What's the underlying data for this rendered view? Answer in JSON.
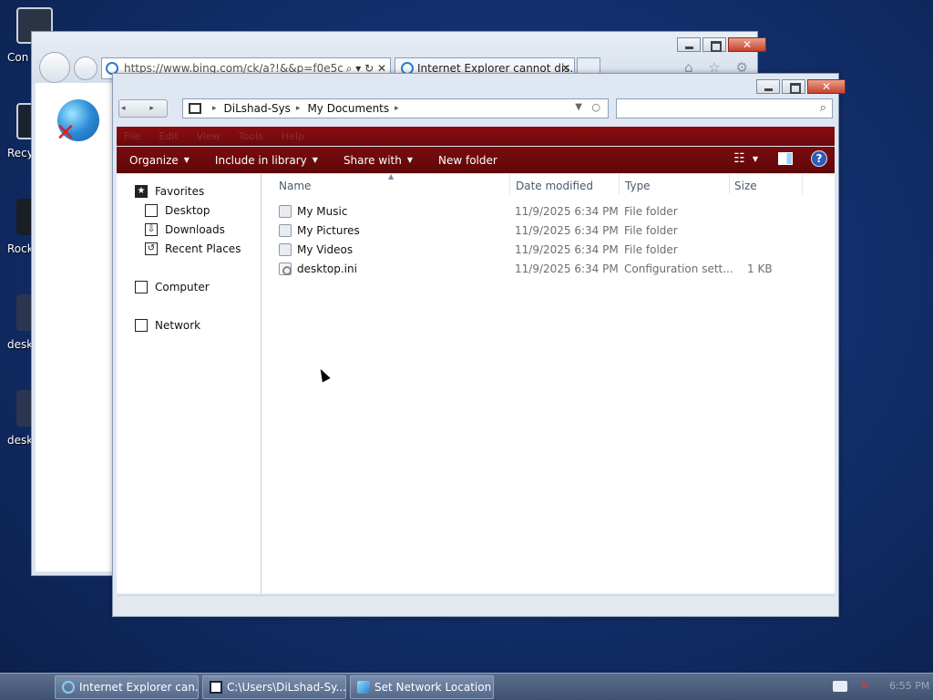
{
  "desktop": {
    "icons": [
      {
        "label": "Con"
      },
      {
        "label": "Recy"
      },
      {
        "label": "Rock"
      },
      {
        "label": "desk"
      },
      {
        "label": "desk"
      }
    ]
  },
  "ie": {
    "address": "https://www.bing.com/ck/a?!&&p=f0e5c",
    "address_controls": "⌕ ▾ ↻ ✕",
    "tab_title": "Internet Explorer cannot dis...",
    "tab_close": "✕",
    "tool_icons": "⌂ ☆ ⚙"
  },
  "explorer": {
    "nav_arrows": "◂ ▸",
    "breadcrumb": [
      "DiLshad-Sys",
      "My Documents"
    ],
    "breadcrumb_sep": "▸",
    "menu": [
      "File",
      "Edit",
      "View",
      "Tools",
      "Help"
    ],
    "commands": [
      {
        "label": "Organize",
        "caret": true
      },
      {
        "label": "Include in library",
        "caret": true
      },
      {
        "label": "Share with",
        "caret": true
      },
      {
        "label": "New folder",
        "caret": false
      }
    ],
    "caret_glyph": "▼",
    "help_glyph": "?",
    "view_glyph": "☷",
    "nav_pane": {
      "favorites": "Favorites",
      "favorites_items": [
        "Desktop",
        "Downloads",
        "Recent Places"
      ],
      "computer": "Computer",
      "network": "Network"
    },
    "columns": {
      "name": "Name",
      "date": "Date modified",
      "type": "Type",
      "size": "Size"
    },
    "sort_glyph": "▲",
    "files": [
      {
        "name": "My Music",
        "date": "11/9/2025 6:34 PM",
        "type": "File folder",
        "size": ""
      },
      {
        "name": "My Pictures",
        "date": "11/9/2025 6:34 PM",
        "type": "File folder",
        "size": ""
      },
      {
        "name": "My Videos",
        "date": "11/9/2025 6:34 PM",
        "type": "File folder",
        "size": ""
      },
      {
        "name": "desktop.ini",
        "date": "11/9/2025 6:34 PM",
        "type": "Configuration sett...",
        "size": "1 KB"
      }
    ]
  },
  "window_controls": {
    "close": "✕"
  },
  "taskbar": {
    "buttons": [
      {
        "label": "Internet Explorer can..."
      },
      {
        "label": "C:\\Users\\DiLshad-Sy..."
      },
      {
        "label": "Set Network Location"
      }
    ],
    "volume_glyph": "✕",
    "clock": "6:55 PM"
  },
  "colors": {
    "desktop_bg": "#13306d",
    "explorer_accent": "#6b0a0c",
    "taskbar": "#4a5c79"
  }
}
